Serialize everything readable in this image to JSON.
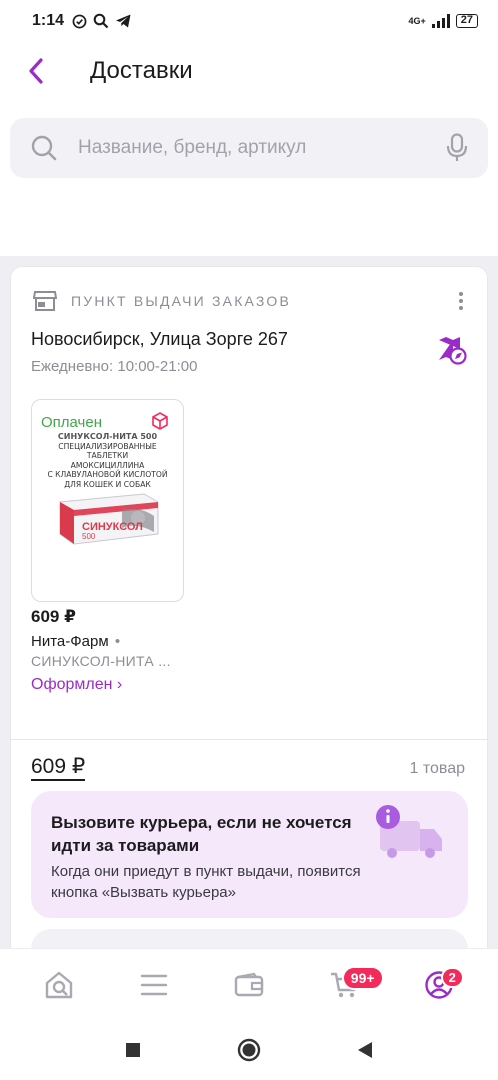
{
  "status_bar": {
    "time": "1:14",
    "network": "4G+",
    "battery": "27"
  },
  "header": {
    "title": "Доставки"
  },
  "search": {
    "placeholder": "Название, бренд, артикул"
  },
  "pickup": {
    "label": "ПУНКТ ВЫДАЧИ ЗАКАЗОВ",
    "address": "Новосибирск, Улица Зорге 267",
    "hours": "Ежедневно: 10:00-21:00"
  },
  "product": {
    "paid_label": "Оплачен",
    "package_title": "СИНУКСОЛ-НИТА 500",
    "package_text": [
      "СПЕЦИАЛИЗИРОВАННЫЕ ТАБЛЕТКИ",
      "АМОКСИЦИЛЛИНА",
      "С КЛАВУЛАНОВОЙ КИСЛОТОЙ",
      "ДЛЯ КОШЕК И СОБАК"
    ],
    "package_brand": "СИНУКСОЛ",
    "package_dose": "500",
    "price": "609 ₽",
    "brand": "Нита-Фарм",
    "brand_separator": "•",
    "name": "СИНУКСОЛ-НИТА ...",
    "status": "Оформлен ›"
  },
  "summary": {
    "total": "609 ₽",
    "count": "1 товар"
  },
  "courier_banner": {
    "title": "Вызовите курьера, если не хочется идти за товарами",
    "subtitle": "Когда они приедут в пункт выдачи, появится кнопка «Вызвать курьера»"
  },
  "bottom_nav": {
    "cart_badge": "99+",
    "profile_badge": "2"
  },
  "colors": {
    "accent": "#9b2bc9",
    "paid": "#3da847",
    "badge": "#f42a5a",
    "banner_bg": "#f6e8fb"
  }
}
